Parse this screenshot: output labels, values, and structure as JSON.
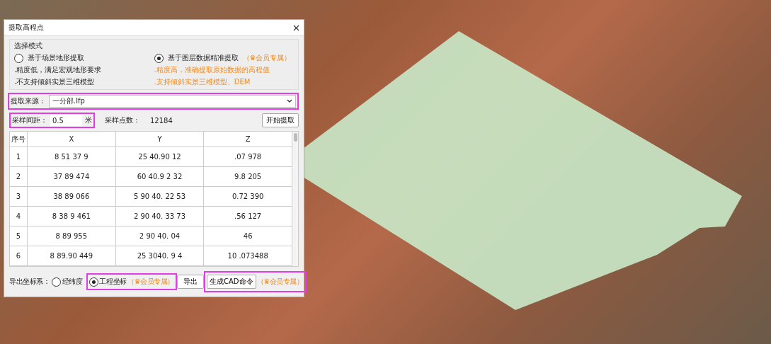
{
  "dialog": {
    "title": "提取高程点",
    "mode_group": {
      "title": "选择模式",
      "options": [
        {
          "label": "基于场景地形提取",
          "selected": false,
          "notes": [
            ".精度低，满足宏观地形要求",
            ".不支持倾斜实景三维模型"
          ]
        },
        {
          "label": "基于图层数据精准提取",
          "badge": "（♛会员专属）",
          "selected": true,
          "notes": [
            ".精度高，准确提取原始数据的高程值",
            ".支持倾斜实景三维模型、DEM"
          ]
        }
      ]
    },
    "source": {
      "label": "提取来源：",
      "value": "一分部.lfp"
    },
    "interval": {
      "label": "采样间距：",
      "value": "0.5",
      "unit": "米"
    },
    "count": {
      "label": "采样点数：",
      "value": "12184"
    },
    "start_button": "开始提取",
    "table": {
      "columns": [
        "序号",
        "X",
        "Y",
        "Z"
      ],
      "rows": [
        [
          "1",
          "8 51 37 9",
          "25 40.90 12",
          ".07 978"
        ],
        [
          "2",
          "37 89 474",
          "60 40.9 2 32",
          "9.8 205"
        ],
        [
          "3",
          "38 89 066",
          "5 90 40. 22 53",
          "0.72 390"
        ],
        [
          "4",
          "8 38 9 461",
          "2 90 40. 33 73",
          ".56 127"
        ],
        [
          "5",
          "8 89 955",
          "2 90 40. 04",
          "46"
        ],
        [
          "6",
          "8 89.90 449",
          "25 3040. 9 4",
          "10 .073488"
        ]
      ]
    },
    "export": {
      "label": "导出坐标系：",
      "options": [
        {
          "label": "经纬度",
          "selected": false
        },
        {
          "label": "工程坐标",
          "badge": "（♛会员专属）",
          "selected": true
        }
      ],
      "button": "导出"
    },
    "cad": {
      "button": "生成CAD命令",
      "badge": "（♛会员专属）"
    }
  }
}
